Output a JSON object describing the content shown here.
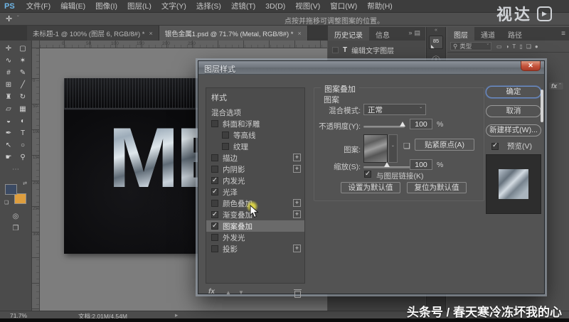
{
  "window": {
    "logo": "PS",
    "controls": {
      "minimize": "–",
      "maximize": "❐",
      "close": "✕"
    }
  },
  "menu_bar": {
    "items": [
      "文件(F)",
      "编辑(E)",
      "图像(I)",
      "图层(L)",
      "文字(Y)",
      "选择(S)",
      "滤镜(T)",
      "3D(D)",
      "视图(V)",
      "窗口(W)",
      "帮助(H)"
    ]
  },
  "options_bar": {
    "tool_glyph": "✛",
    "dropdown_glyph": "ˇ",
    "hint": "点按并拖移可调整图案的位置。"
  },
  "brand": {
    "text": "视达",
    "play_glyph": "▶"
  },
  "document_tabs": [
    {
      "label": "未标题-1 @ 100% (图层 6, RGB/8#) *",
      "close": "×",
      "active": false
    },
    {
      "label": "银色金属1.psd @ 71.7% (Metal, RGB/8#) *",
      "close": "×",
      "active": true
    }
  ],
  "toolbar": {
    "fg_color": "#3b4a63",
    "bg_color": "#de9e3e",
    "swap_glyph": "⇄",
    "mini_glyph": "❏",
    "mask_glyph": "◎",
    "screen_glyph": "❐",
    "tools": [
      {
        "name": "move-tool",
        "glyph": "✛"
      },
      {
        "name": "marquee-tool",
        "glyph": "▢"
      },
      {
        "name": "lasso-tool",
        "glyph": "∿"
      },
      {
        "name": "magic-wand-tool",
        "glyph": "✶"
      },
      {
        "name": "crop-tool",
        "glyph": "#"
      },
      {
        "name": "eyedropper-tool",
        "glyph": "✎"
      },
      {
        "name": "healing-brush-tool",
        "glyph": "⊞"
      },
      {
        "name": "brush-tool",
        "glyph": "╱"
      },
      {
        "name": "clone-stamp-tool",
        "glyph": "♜"
      },
      {
        "name": "history-brush-tool",
        "glyph": "↻"
      },
      {
        "name": "eraser-tool",
        "glyph": "▱"
      },
      {
        "name": "gradient-tool",
        "glyph": "▦"
      },
      {
        "name": "blur-tool",
        "glyph": "◒"
      },
      {
        "name": "dodge-tool",
        "glyph": "◐"
      },
      {
        "name": "pen-tool",
        "glyph": "✒"
      },
      {
        "name": "type-tool",
        "glyph": "T"
      },
      {
        "name": "path-select-tool",
        "glyph": "↖"
      },
      {
        "name": "shape-tool",
        "glyph": "○"
      },
      {
        "name": "hand-tool",
        "glyph": "☛"
      },
      {
        "name": "zoom-tool",
        "glyph": "⚲"
      },
      {
        "name": "more-tools",
        "glyph": "⋯"
      }
    ]
  },
  "rulers": {
    "top": [
      "0",
      "50",
      "100",
      "150",
      "200",
      "250"
    ],
    "left": [
      "0",
      "50",
      "100",
      "150",
      "200",
      "250",
      "300"
    ]
  },
  "canvas": {
    "text": "ME"
  },
  "history_panel": {
    "tabs": [
      {
        "label": "历史记录",
        "active": true
      },
      {
        "label": "信息",
        "active": false
      }
    ],
    "expand_glyph": "»",
    "list_glyph": "▤",
    "item": {
      "icon": "T",
      "label": "编辑文字图层"
    }
  },
  "dock": {
    "collapse_glyph": "«",
    "brush_label": "85",
    "brush_tip_glyph": "◣",
    "info_glyph": "ⓘ"
  },
  "layers_panel": {
    "tabs": [
      {
        "label": "图层",
        "active": true
      },
      {
        "label": "通道",
        "active": false
      },
      {
        "label": "路径",
        "active": false
      }
    ],
    "menu_glyph": "≡",
    "filter": {
      "search_glyph": "⚲",
      "label": "类型",
      "dropdown_glyph": "ˇ"
    },
    "filter_icons": [
      {
        "name": "filter-pixel-icon",
        "glyph": "▭"
      },
      {
        "name": "filter-adjustment-icon",
        "glyph": "◑"
      },
      {
        "name": "filter-type-icon",
        "glyph": "T"
      },
      {
        "name": "filter-shape-icon",
        "glyph": "▯"
      },
      {
        "name": "filter-smart-icon",
        "glyph": "❏"
      },
      {
        "name": "filter-dot-icon",
        "glyph": "●"
      }
    ],
    "fx_badge": "fx",
    "fx_chevron": "ˆ"
  },
  "dialog": {
    "title": "图层样式",
    "close_glyph": "✕",
    "styles_header": "样式",
    "styles": [
      {
        "label": "混合选项"
      },
      {
        "label": "斜面和浮雕",
        "checked": false
      },
      {
        "label": "等高线",
        "checked": false,
        "indent": true
      },
      {
        "label": "纹理",
        "checked": false,
        "indent": true
      },
      {
        "label": "描边",
        "checked": false,
        "plus": true
      },
      {
        "label": "内阴影",
        "checked": false,
        "plus": true
      },
      {
        "label": "内发光",
        "checked": true
      },
      {
        "label": "光泽",
        "checked": true
      },
      {
        "label": "颜色叠加",
        "checked": false,
        "plus": true
      },
      {
        "label": "渐变叠加",
        "checked": true,
        "plus": true
      },
      {
        "label": "图案叠加",
        "checked": true,
        "selected": true
      },
      {
        "label": "外发光",
        "checked": false
      },
      {
        "label": "投影",
        "checked": false,
        "plus": true
      }
    ],
    "footer": {
      "fx": "fx",
      "up": "▲",
      "down": "▼"
    },
    "section_title": "图案叠加",
    "group_label": "图案",
    "blend_mode": {
      "label": "混合模式:",
      "value": "正常",
      "dropdown_glyph": "ˇ"
    },
    "opacity": {
      "label": "不透明度(Y):",
      "value": "100",
      "unit": "%"
    },
    "pattern": {
      "label": "图案:",
      "dropdown_glyph": "ˇ",
      "snap_glyph": "❏",
      "snap_button": "贴紧原点(A)"
    },
    "scale": {
      "label": "缩放(S):",
      "value": "100",
      "unit": "%"
    },
    "link": {
      "label": "与图层链接(K)",
      "checked": true
    },
    "defaults": {
      "set": "设置为默认值",
      "reset": "复位为默认值"
    },
    "actions": {
      "ok": "确定",
      "cancel": "取消",
      "new_style": "新建样式(W)...",
      "preview": "预览(V)"
    }
  },
  "status_bar": {
    "zoom": "71.7%",
    "doc_info": "文档:2.01M/4.54M",
    "arrow_glyph": "▸"
  },
  "watermark": {
    "text": "头条号 / 春天寒冷冻坏我的心"
  }
}
